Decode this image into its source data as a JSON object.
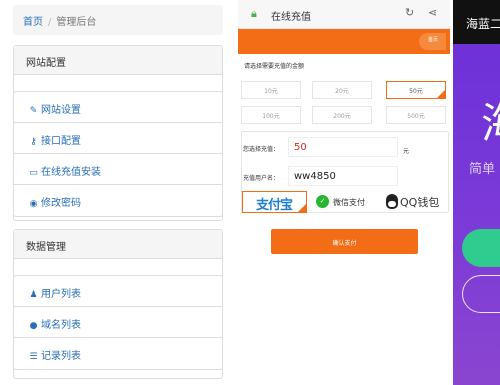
{
  "admin": {
    "breadcrumb": {
      "home": "首页",
      "current": "管理后台"
    },
    "site_section": {
      "title": "网站配置",
      "items": [
        {
          "icon": "edit-icon",
          "label": "网站设置"
        },
        {
          "icon": "key-icon",
          "label": "接口配置"
        },
        {
          "icon": "credit-card-icon",
          "label": "在线充值安装"
        },
        {
          "icon": "user-circle-icon",
          "label": "修改密码"
        }
      ]
    },
    "data_section": {
      "title": "数据管理",
      "items": [
        {
          "icon": "user-icon",
          "label": "用户列表"
        },
        {
          "icon": "globe-icon",
          "label": "域名列表"
        },
        {
          "icon": "list-icon",
          "label": "记录列表"
        }
      ]
    }
  },
  "recharge": {
    "browser_title": "在线充值",
    "home_button": "首页",
    "prompt": "请选择需要充值的金额",
    "amounts": [
      "10元",
      "20元",
      "50元",
      "100元",
      "200元",
      "500元"
    ],
    "selected_amount_index": 2,
    "amount_label": "您选择充值：",
    "amount_value": "50",
    "unit": "元",
    "user_label": "充值用户名：",
    "user_value": "ww4850",
    "pay_methods": {
      "alipay": "支付宝",
      "wechat": "微信支付",
      "qq": "QQ钱包"
    },
    "confirm_button": "确认支付",
    "colors": {
      "accent": "#f36d16",
      "link": "#2a6eb8"
    }
  },
  "landing": {
    "brand": "海蓝二",
    "headline": "海",
    "subtitle": "简单",
    "colors": {
      "background": "#7b3ad8",
      "primary_button": "#2fcb8f"
    }
  }
}
